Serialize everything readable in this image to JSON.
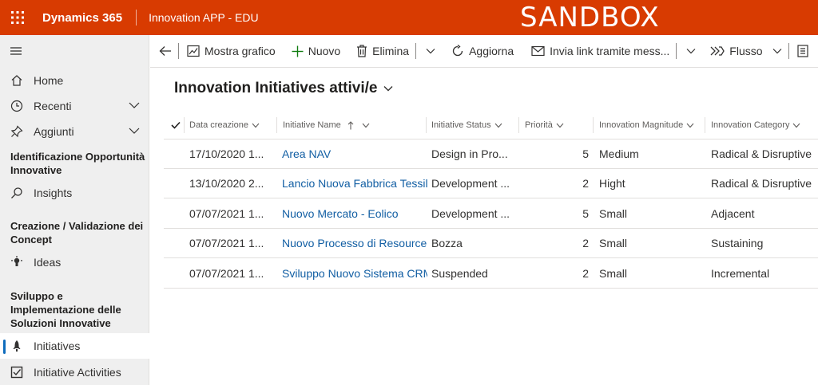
{
  "topbar": {
    "brand": "Dynamics 365",
    "app_name": "Innovation APP - EDU",
    "environment_label": "SANDBOX"
  },
  "sidebar": {
    "items": [
      {
        "label": "Home",
        "icon": "home-icon"
      },
      {
        "label": "Recenti",
        "icon": "clock-icon"
      },
      {
        "label": "Aggiunti",
        "icon": "pin-icon"
      }
    ],
    "sections": [
      {
        "title": "Identificazione Opportunità Innovative",
        "items": [
          {
            "label": "Insights",
            "icon": "search-icon"
          }
        ]
      },
      {
        "title": "Creazione / Validazione dei Concept",
        "items": [
          {
            "label": "Ideas",
            "icon": "lightbulb-icon"
          }
        ]
      },
      {
        "title": "Sviluppo e Implementazione delle Soluzioni Innovative",
        "items": [
          {
            "label": "Initiatives",
            "icon": "rocket-icon",
            "active": true
          },
          {
            "label": "Initiative Activities",
            "icon": "checkbox-icon"
          }
        ]
      }
    ]
  },
  "commandbar": {
    "show_chart": "Mostra grafico",
    "new": "Nuovo",
    "delete": "Elimina",
    "refresh": "Aggiorna",
    "email_link": "Invia link tramite mess...",
    "flow": "Flusso"
  },
  "view": {
    "title": "Innovation Initiatives attivi/e"
  },
  "grid": {
    "columns": [
      "Data creazione",
      "Initiative Name",
      "Initiative Status",
      "Priorità",
      "Innovation Magnitude",
      "Innovation Category"
    ],
    "rows": [
      {
        "date": "17/10/2020 1...",
        "name": "Area NAV",
        "status": "Design in Pro...",
        "priority": "5",
        "magnitude": "Medium",
        "category": "Radical & Disruptive"
      },
      {
        "date": "13/10/2020 2...",
        "name": "Lancio Nuova Fabbrica Tessile...",
        "status": "Development ...",
        "priority": "2",
        "magnitude": "Hight",
        "category": "Radical & Disruptive"
      },
      {
        "date": "07/07/2021 1...",
        "name": "Nuovo Mercato  - Eolico",
        "status": "Development ...",
        "priority": "5",
        "magnitude": "Small",
        "category": "Adjacent"
      },
      {
        "date": "07/07/2021 1...",
        "name": "Nuovo Processo di Resource Hi",
        "status": "Bozza",
        "priority": "2",
        "magnitude": "Small",
        "category": "Sustaining"
      },
      {
        "date": "07/07/2021 1...",
        "name": "Sviluppo Nuovo Sistema CRM I",
        "status": "Suspended",
        "priority": "2",
        "magnitude": "Small",
        "category": "Incremental"
      }
    ]
  }
}
